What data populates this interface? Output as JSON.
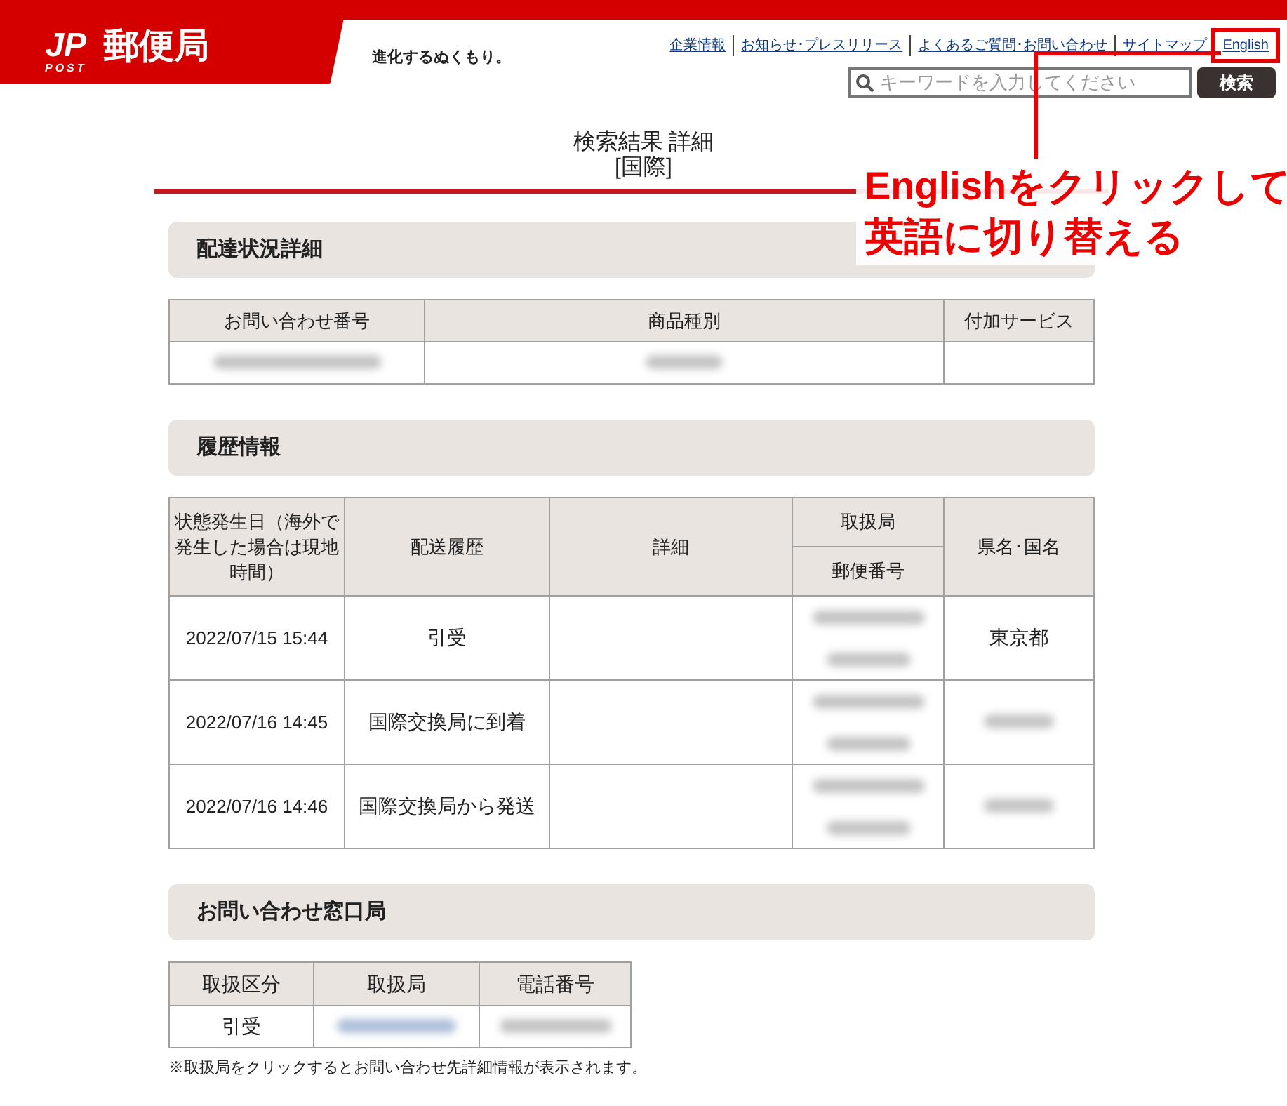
{
  "header": {
    "logo_mark": "JP",
    "logo_sub": "POST",
    "logo_text": "郵便局",
    "tagline": "進化するぬくもり。",
    "links": [
      {
        "label": "企業情報",
        "highlighted": false
      },
      {
        "label": "お知らせ･プレスリリース",
        "highlighted": false
      },
      {
        "label": "よくあるご質問･お問い合わせ",
        "highlighted": false
      },
      {
        "label": "サイトマップ",
        "highlighted": false
      },
      {
        "label": "English",
        "highlighted": true
      }
    ],
    "search": {
      "placeholder": "キーワードを入力してください",
      "button": "検索"
    }
  },
  "page_title": [
    "検索結果 詳細",
    "[国際]"
  ],
  "annotation": {
    "lines": [
      "Englishをクリックして",
      "英語に切り替える"
    ]
  },
  "delivery_status": {
    "heading": "配達状況詳細",
    "columns": [
      "お問い合わせ番号",
      "商品種別",
      "付加サービス"
    ],
    "row": [
      {
        "redacted": true
      },
      {
        "redacted": true
      },
      {
        "redacted": false
      }
    ]
  },
  "history": {
    "heading": "履歴情報",
    "columns": {
      "date": "状態発生日（海外で発生した場合は現地時間）",
      "event": "配送履歴",
      "detail": "詳細",
      "office": "取扱局",
      "postcode": "郵便番号",
      "region": "県名･国名"
    },
    "rows": [
      {
        "date": "2022/07/15 15:44",
        "event": "引受",
        "office_redacted": true,
        "region": "東京都",
        "region_redacted": false
      },
      {
        "date": "2022/07/16 14:45",
        "event": "国際交換局に到着",
        "office_redacted": true,
        "region_redacted": true
      },
      {
        "date": "2022/07/16 14:46",
        "event": "国際交換局から発送",
        "office_redacted": true,
        "region_redacted": true
      }
    ]
  },
  "contact_office": {
    "heading": "お問い合わせ窓口局",
    "columns": [
      "取扱区分",
      "取扱局",
      "電話番号"
    ],
    "row": [
      {
        "text": "引受",
        "redacted": false
      },
      {
        "redacted": true,
        "color": "#aebfd9"
      },
      {
        "redacted": true,
        "color": "#c4c4c4"
      }
    ],
    "note": "※取扱局をクリックするとお問い合わせ先詳細情報が表示されます。"
  }
}
